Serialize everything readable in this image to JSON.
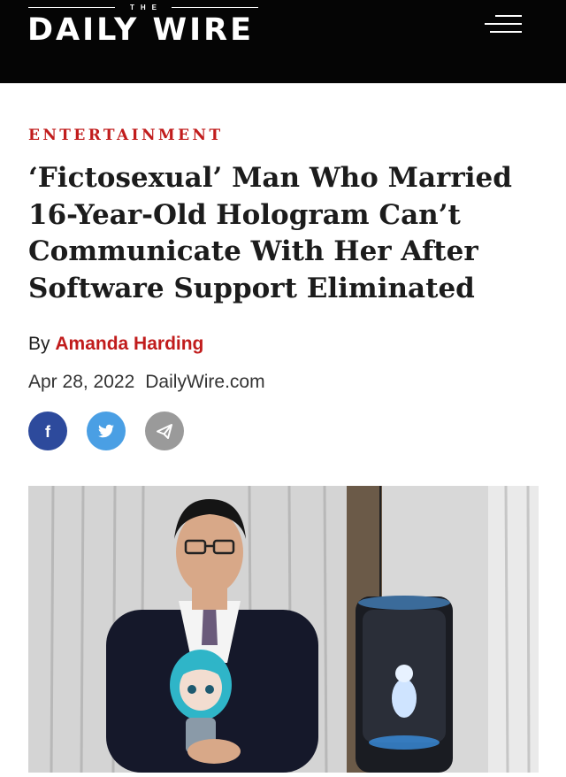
{
  "brand": {
    "the": "THE",
    "name": "DAILY WIRE"
  },
  "header": {
    "menu_icon": "hamburger-menu-icon"
  },
  "article": {
    "category": "ENTERTAINMENT",
    "headline": "‘Fictosexual’ Man Who Married 16-Year-Old Hologram Can’t Communicate With Her After Software Support Eliminated",
    "byline_prefix": "By",
    "author": "Amanda Harding",
    "date": "Apr 28, 2022",
    "source": "DailyWire.com"
  },
  "share": {
    "buttons": [
      {
        "icon": "facebook-icon",
        "color": "#2d4a9c"
      },
      {
        "icon": "twitter-icon",
        "color": "#4a9fe4"
      },
      {
        "icon": "email-send-icon",
        "color": "#9a9a9a"
      }
    ]
  },
  "colors": {
    "header_bg": "#050505",
    "accent_red": "#c11c1c"
  }
}
